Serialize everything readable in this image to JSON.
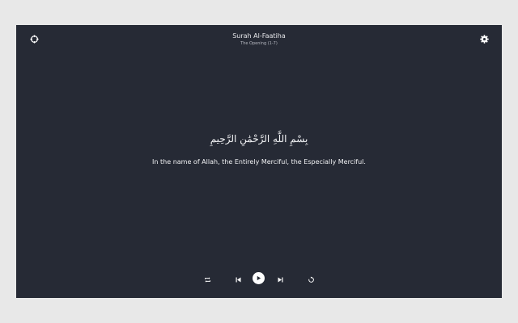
{
  "header": {
    "title": "Surah Al-Faatiha",
    "subtitle": "The Opening (1-7)"
  },
  "verse": {
    "arabic": "بِسْمِ اللَّهِ الرَّحْمَٰنِ الرَّحِيمِ",
    "translation": "In the name of Allah, the Entirely Merciful, the Especially Merciful."
  },
  "icons": {
    "top_left": "crosshair-icon",
    "top_right": "gear-icon",
    "repeat": "repeat-icon",
    "previous": "skip-previous-icon",
    "play": "play-icon",
    "next": "skip-next-icon",
    "replay": "replay-icon"
  },
  "colors": {
    "background": "#262a35",
    "text": "#ffffff",
    "page": "#e8e8e8"
  }
}
